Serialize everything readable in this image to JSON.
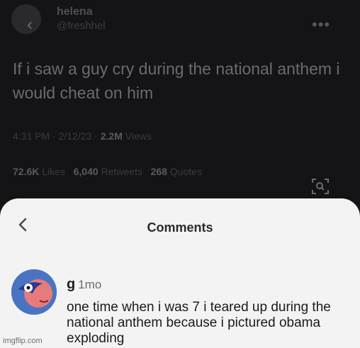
{
  "tweet": {
    "author_name": "helena",
    "author_handle": "@freshhel",
    "text": "If i saw a guy cry during the national anthem i would cheat on him",
    "time": "4:31 PM · 2/12/23 ·",
    "views_count": "2.2M",
    "views_label": "Views",
    "likes_count": "72.6K",
    "likes_label": "Likes",
    "retweets_count": "6,040",
    "retweets_label": "Retweets",
    "quotes_count": "268",
    "quotes_label": "Quotes"
  },
  "comments_sheet": {
    "title": "Comments",
    "comment": {
      "username": "g",
      "age": "1mo",
      "text": "one time when i was 7 i teared up during the national anthem because i pictured obama exploding"
    }
  },
  "watermark": "imgflip.com",
  "colors": {
    "background": "#17171a",
    "sheet": "#f3f3f4",
    "comment_text": "#1a1a1d"
  }
}
